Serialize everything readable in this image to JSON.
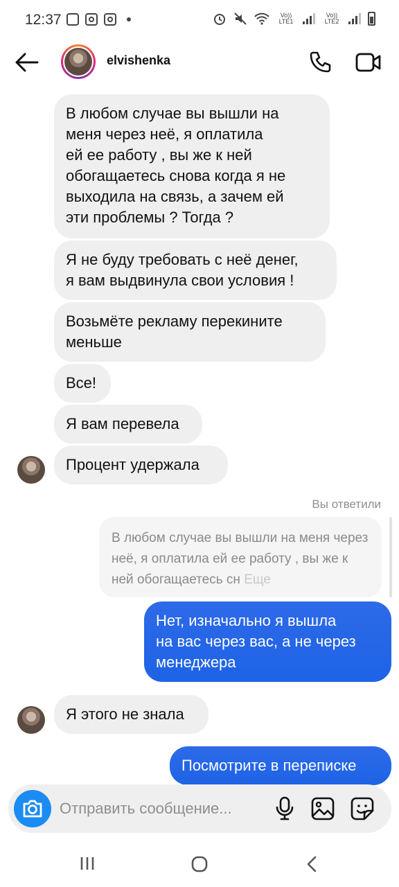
{
  "status_bar": {
    "time": "12:37",
    "sim1_label": "Vo)) LTE1",
    "sim2_label": "Vo)) LTE2"
  },
  "header": {
    "username": "elvishenka",
    "icons": [
      "back-arrow-icon",
      "phone-icon",
      "video-camera-icon"
    ]
  },
  "messages": [
    {
      "side": "in",
      "text": "В любом случае вы вышли на\nменя через неё, я оплатила\nей ее работу , вы же к ней\nобогащаетесь снова когда я не\nвыходила на связь, а зачем ей\nэти проблемы ? Тогда ?"
    },
    {
      "side": "in",
      "text": "Я не буду требовать с неё денег,\nя вам выдвинула свои условия !"
    },
    {
      "side": "in",
      "text": "Возьмёте рекламу перекините\nменьше"
    },
    {
      "side": "in",
      "text": "Все!"
    },
    {
      "side": "in",
      "text": "Я вам перевела"
    },
    {
      "side": "in",
      "text": "Процент удержала"
    },
    {
      "side": "out",
      "text": "Нет, изначально я вышла\nна вас через вас, а не через\nменеджера"
    },
    {
      "side": "in",
      "text": "Я этого не знала"
    },
    {
      "side": "out",
      "text": "Посмотрите в переписке"
    }
  ],
  "reply": {
    "label": "Вы ответили",
    "quote": "В любом случае вы вышли на меня через неё, я оплатила ей ее работу , вы же к ней обогащаетесь сн",
    "more": "Еще"
  },
  "composer": {
    "placeholder": "Отправить сообщение...",
    "icons": [
      "camera-icon",
      "microphone-icon",
      "gallery-icon",
      "sticker-icon"
    ]
  },
  "colors": {
    "outgoing_bubble": "#1e63e6",
    "incoming_bubble": "#efefef",
    "camera_button": "#1a8cf3"
  }
}
